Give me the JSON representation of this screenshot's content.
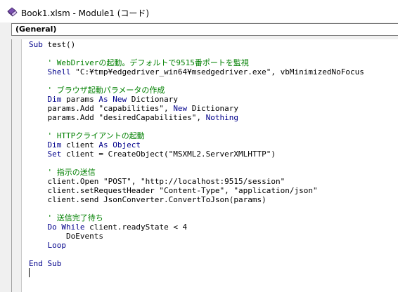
{
  "window": {
    "title": "Book1.xlsm - Module1 (コード)",
    "icon": "vba-module-icon"
  },
  "procedure_combo": {
    "value": "(General)"
  },
  "code": {
    "lines": [
      [
        {
          "t": "kw",
          "v": "Sub"
        },
        {
          "t": "tx",
          "v": " test()"
        }
      ],
      [],
      [
        {
          "t": "cm",
          "v": "    ' WebDriverの起動。デフォルトで9515番ポートを監視"
        }
      ],
      [
        {
          "t": "kw",
          "v": "    Shell"
        },
        {
          "t": "tx",
          "v": " \"C:¥tmp¥edgedriver_win64¥msedgedriver.exe\", vbMinimizedNoFocus"
        }
      ],
      [],
      [
        {
          "t": "cm",
          "v": "    ' ブラウザ起動パラメータの作成"
        }
      ],
      [
        {
          "t": "kw",
          "v": "    Dim"
        },
        {
          "t": "tx",
          "v": " params "
        },
        {
          "t": "kw",
          "v": "As New"
        },
        {
          "t": "tx",
          "v": " Dictionary"
        }
      ],
      [
        {
          "t": "tx",
          "v": "    params.Add \"capabilities\", "
        },
        {
          "t": "kw",
          "v": "New"
        },
        {
          "t": "tx",
          "v": " Dictionary"
        }
      ],
      [
        {
          "t": "tx",
          "v": "    params.Add \"desiredCapabilities\", "
        },
        {
          "t": "kw",
          "v": "Nothing"
        }
      ],
      [],
      [
        {
          "t": "cm",
          "v": "    ' HTTPクライアントの起動"
        }
      ],
      [
        {
          "t": "kw",
          "v": "    Dim"
        },
        {
          "t": "tx",
          "v": " client "
        },
        {
          "t": "kw",
          "v": "As Object"
        }
      ],
      [
        {
          "t": "kw",
          "v": "    Set"
        },
        {
          "t": "tx",
          "v": " client = CreateObject(\"MSXML2.ServerXMLHTTP\")"
        }
      ],
      [],
      [
        {
          "t": "cm",
          "v": "    ' 指示の送信"
        }
      ],
      [
        {
          "t": "tx",
          "v": "    client.Open \"POST\", \"http://localhost:9515/session\""
        }
      ],
      [
        {
          "t": "tx",
          "v": "    client.setRequestHeader \"Content-Type\", \"application/json\""
        }
      ],
      [
        {
          "t": "tx",
          "v": "    client.send JsonConverter.ConvertToJson(params)"
        }
      ],
      [],
      [
        {
          "t": "cm",
          "v": "    ' 送信完了待ち"
        }
      ],
      [
        {
          "t": "kw",
          "v": "    Do While"
        },
        {
          "t": "tx",
          "v": " client.readyState < 4"
        }
      ],
      [
        {
          "t": "tx",
          "v": "        DoEvents"
        }
      ],
      [
        {
          "t": "kw",
          "v": "    Loop"
        }
      ],
      [],
      [
        {
          "t": "kw",
          "v": "End Sub"
        }
      ]
    ]
  }
}
